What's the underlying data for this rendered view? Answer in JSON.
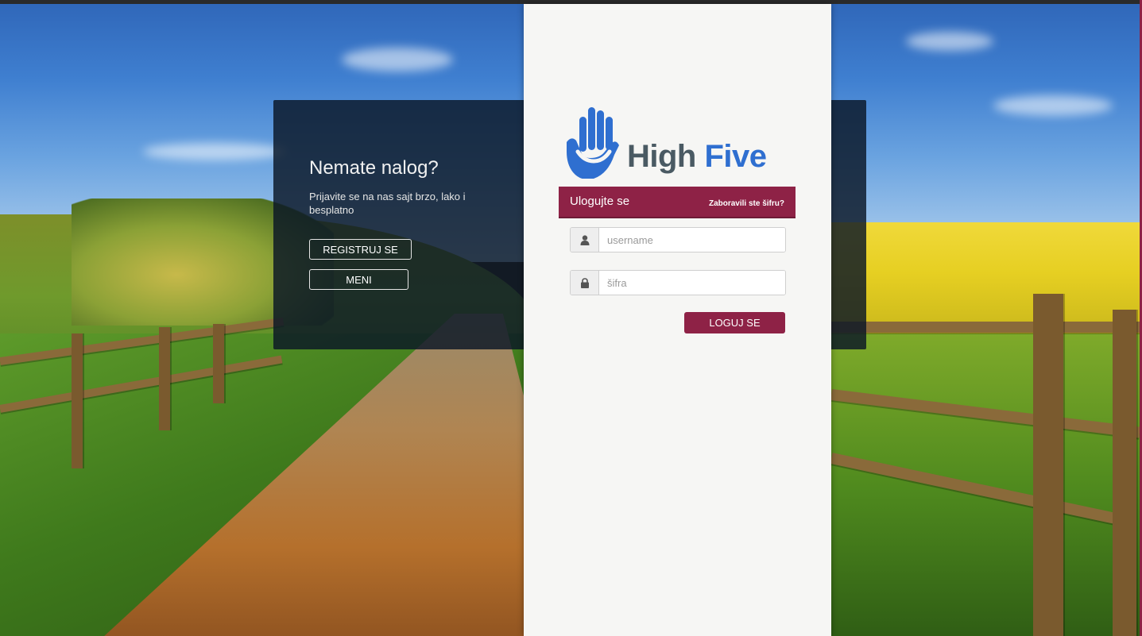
{
  "info_panel": {
    "title": "Nemate nalog?",
    "description": "Prijavite se na nas sajt brzo, lako i besplatno",
    "register_label": "REGISTRUJ SE",
    "menu_label": "MENI"
  },
  "logo": {
    "word_high": "High",
    "word_five": "Five"
  },
  "login": {
    "title": "Ulogujte se",
    "forgot_label": "Zaboravili ste šifru?",
    "username_placeholder": "username",
    "password_placeholder": "šifra",
    "submit_label": "LOGUJ SE"
  },
  "colors": {
    "accent": "#8e2246",
    "logo_blue": "#2f6fd0",
    "logo_gray": "#4a5a63"
  },
  "icons": {
    "username": "user-icon",
    "password": "lock-icon",
    "logo": "hand-icon"
  }
}
